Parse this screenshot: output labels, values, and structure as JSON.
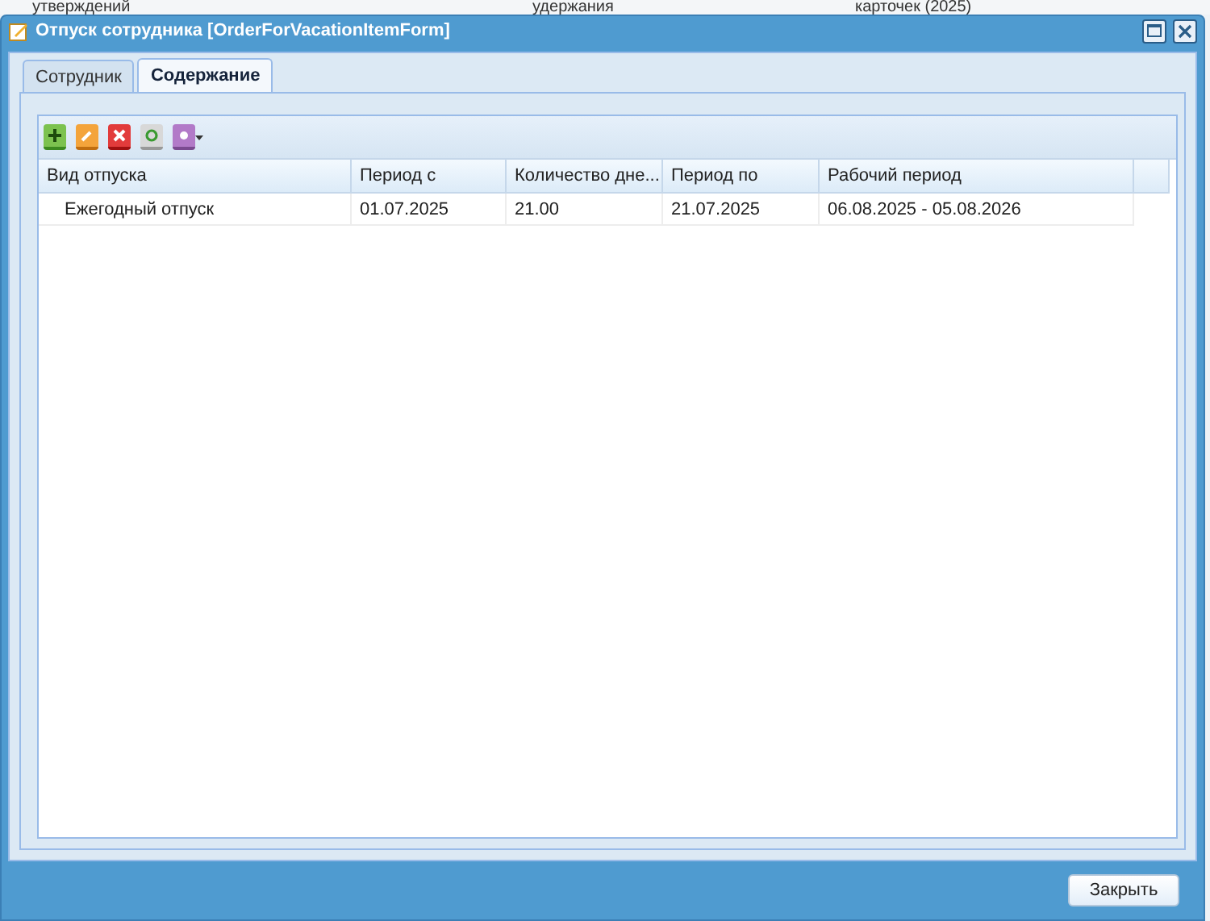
{
  "background_row": [
    "утверждений",
    "удержания",
    "карточек (2025)"
  ],
  "window": {
    "title": "Отпуск сотрудника [OrderForVacationItemForm]"
  },
  "tabs": [
    {
      "label": "Сотрудник",
      "selected": false
    },
    {
      "label": "Содержание",
      "selected": true
    }
  ],
  "toolbar": [
    {
      "kind": "add"
    },
    {
      "kind": "edit"
    },
    {
      "kind": "delete"
    },
    {
      "kind": "refresh"
    },
    {
      "kind": "menu"
    }
  ],
  "table": {
    "columns": [
      "Вид отпуска",
      "Период с",
      "Количество дне...",
      "Период по",
      "Рабочий период"
    ],
    "rows": [
      [
        "Ежегодный отпуск",
        "01.07.2025",
        "21.00",
        "21.07.2025",
        "06.08.2025 - 05.08.2026"
      ]
    ]
  },
  "buttons": [
    "Закрыть"
  ]
}
